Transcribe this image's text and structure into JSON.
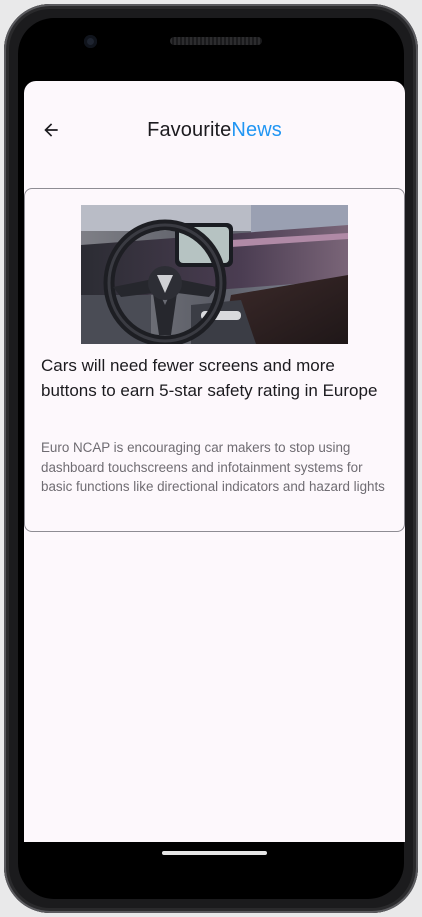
{
  "app_bar": {
    "title_part1": "Favourite",
    "title_part2": "News",
    "back_icon": "arrow-back-icon",
    "accent_color": "#2196f3"
  },
  "articles": [
    {
      "image_subject": "car-interior-photo",
      "title": "Cars will need fewer screens and more buttons to earn 5-star safety rating in Europe",
      "description": "Euro NCAP is encouraging car makers to stop using dashboard touchscreens and infotainment systems for basic functions like directional indicators and hazard lights"
    }
  ]
}
